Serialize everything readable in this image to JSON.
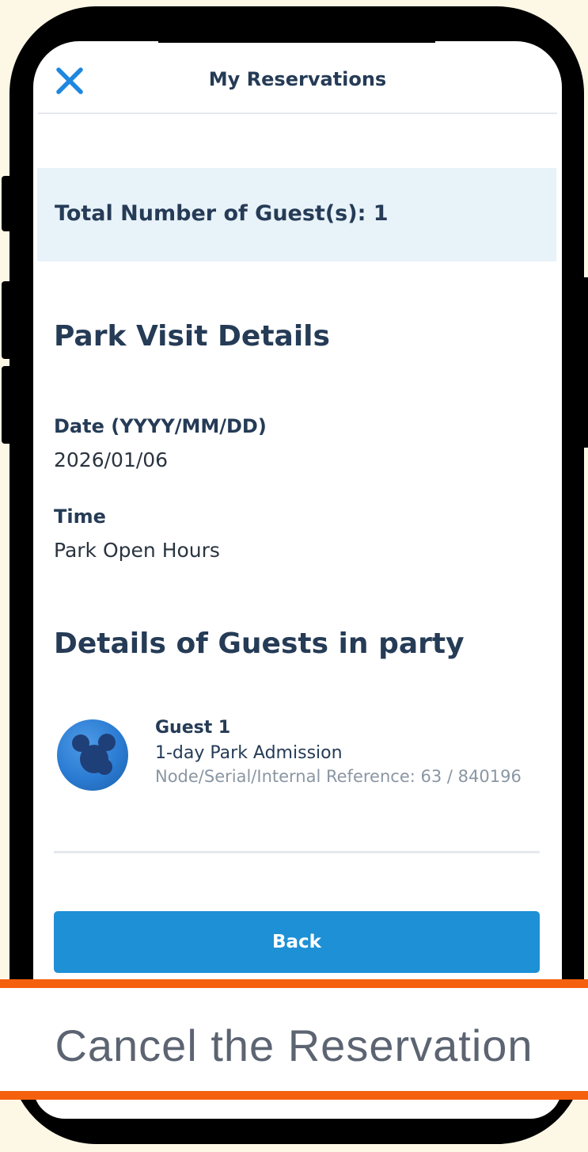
{
  "header": {
    "title": "My Reservations",
    "close_icon": "close-icon"
  },
  "summary": {
    "total_guests": "Total Number of Guest(s): 1"
  },
  "visit": {
    "heading": "Park Visit Details",
    "date_label": "Date (YYYY/MM/DD)",
    "date_value": "2026/01/06",
    "time_label": "Time",
    "time_value": "Park Open Hours"
  },
  "party": {
    "heading": "Details of Guests in party",
    "guests": [
      {
        "name": "Guest 1",
        "ticket": "1-day Park Admission",
        "reference": "Node/Serial/Internal Reference: 63 / 840196",
        "avatar_icon": "mouse-avatar-icon"
      }
    ]
  },
  "actions": {
    "back_label": "Back"
  },
  "overlay": {
    "cancel_label": "Cancel the Reservation"
  },
  "colors": {
    "accent": "#1e90d6",
    "heading": "#253b56",
    "banner_bg": "#e8f2f9",
    "highlight": "#f5600f"
  }
}
